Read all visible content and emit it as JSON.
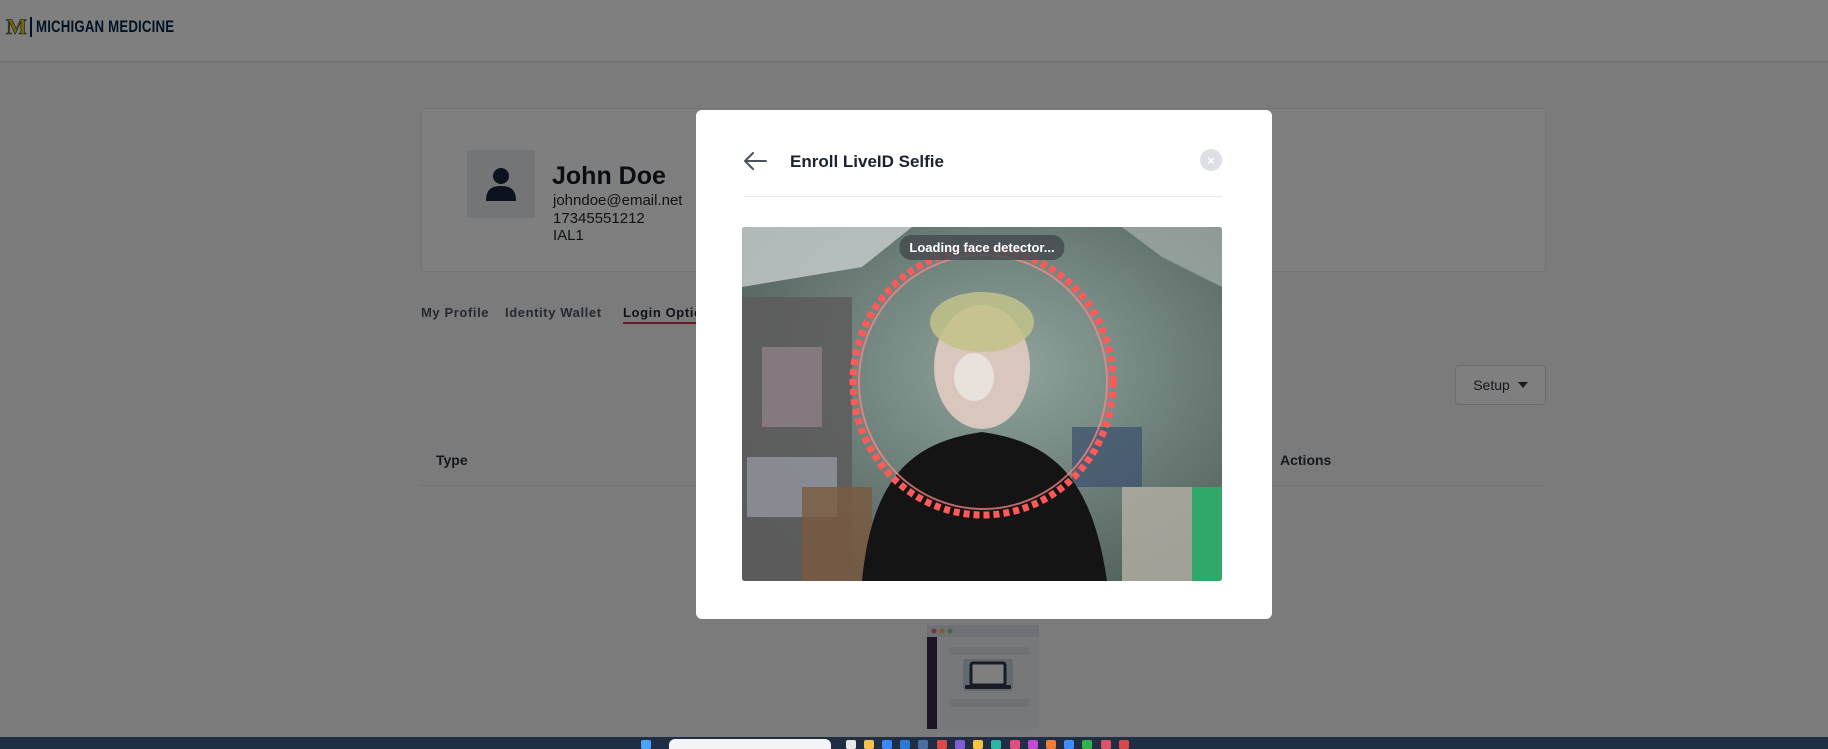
{
  "header": {
    "logo_mark": "M",
    "logo_text": "MICHIGAN MEDICINE"
  },
  "profile": {
    "name": "John Doe",
    "email": "johndoe@email.net",
    "phone": "17345551212",
    "level": "IAL1"
  },
  "tabs": [
    {
      "label": "My Profile"
    },
    {
      "label": "Identity Wallet"
    },
    {
      "label": "Login Options"
    }
  ],
  "setup_button": {
    "label": "Setup"
  },
  "table": {
    "col_type": "Type",
    "col_actions": "Actions"
  },
  "modal": {
    "title": "Enroll LiveID Selfie",
    "camera_status": "Loading face detector...",
    "close_glyph": "×"
  },
  "colors": {
    "accent_red": "#cf3a3a",
    "brand_blue": "#00274c",
    "brand_maize": "#ffcb05",
    "face_ring": "#ff5a5a"
  }
}
